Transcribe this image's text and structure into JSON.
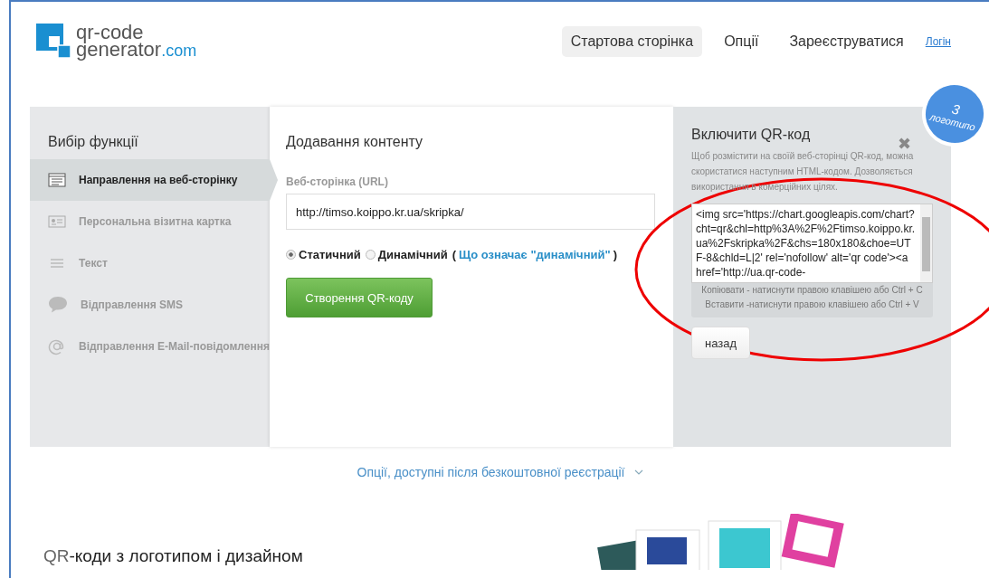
{
  "logo": {
    "line1": "qr-code",
    "line2": "generator",
    "suffix": ".com"
  },
  "nav": [
    {
      "label": "Стартова сторінка",
      "selected": true,
      "kind": "tab"
    },
    {
      "label": "Опції",
      "selected": false,
      "kind": "tab"
    },
    {
      "label": "Зареєструватися",
      "selected": false,
      "kind": "tab"
    },
    {
      "label": "Логін",
      "selected": false,
      "kind": "link"
    }
  ],
  "badge": {
    "number": "3",
    "text": "логотипо"
  },
  "sidebar": {
    "title": "Вибір функції",
    "items": [
      {
        "label": "Направлення на веб-сторінку",
        "kind": "web",
        "selected": true
      },
      {
        "label": "Персональна візитна картка",
        "kind": "card",
        "selected": false
      },
      {
        "label": "Текст",
        "kind": "text",
        "selected": false
      },
      {
        "label": "Відправлення SMS",
        "kind": "sms",
        "selected": false
      },
      {
        "label": "Відправлення E-Mail-повідомлення",
        "kind": "email",
        "selected": false
      }
    ]
  },
  "content": {
    "title": "Додавання контенту",
    "url_label": "Веб-сторінка (URL)",
    "url_value": "http://timso.koippo.kr.ua/skripka/",
    "options": [
      {
        "label": "Статичний",
        "selected": true
      },
      {
        "label": "Динамічний",
        "selected": false
      }
    ],
    "help_open": "(",
    "help_link": "Що означає \"динамічний\"",
    "help_close": ")",
    "create_button": "Створення QR-коду"
  },
  "embed": {
    "close": "✖",
    "title": "Включити QR-код",
    "description": "Щоб розмістити на своїй веб-сторінці QR-код, можна скористатися наступним HTML-кодом. Дозволяється використання в комерційних цілях.",
    "code": "<img src='https://chart.googleapis.com/chart?cht=qr&chl=http%3A%2F%2Ftimso.koippo.kr.ua%2Fskripka%2F&chs=180x180&choe=UTF-8&chld=L|2' rel='nofollow' alt='qr code'><a href='http://ua.qr-code-",
    "hints": [
      "Копіювати - натиснути правою клавішею або Ctrl + C",
      "Вставити -натиснути правою клавішею або Ctrl + V"
    ],
    "back_button": "назад"
  },
  "more_link": "Опції, доступні після безкоштовної реєстрації",
  "promo": {
    "prefix": "QR",
    "title": "-коди з логотипом і дизайном"
  }
}
